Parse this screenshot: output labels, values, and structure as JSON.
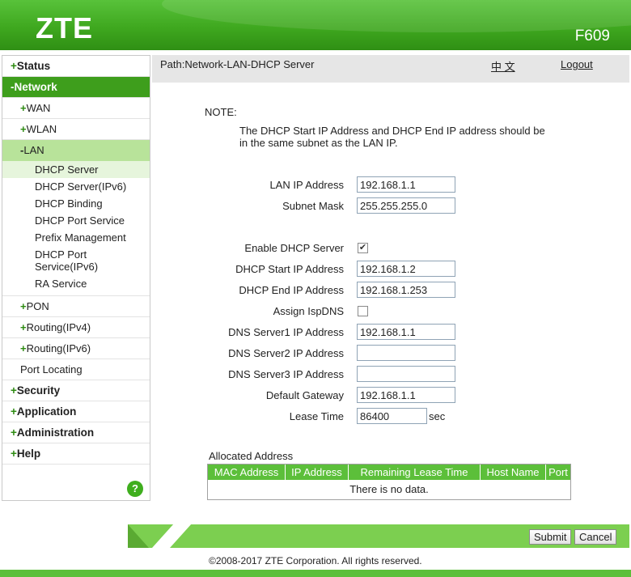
{
  "header": {
    "logo": "ZTE",
    "model": "F609"
  },
  "sidebar": {
    "items": [
      {
        "sign": "+",
        "label": "Status",
        "level": "top"
      },
      {
        "sign": "-",
        "label": "Network",
        "level": "top-active"
      },
      {
        "sign": "+",
        "label": "WAN",
        "level": "sub"
      },
      {
        "sign": "+",
        "label": "WLAN",
        "level": "sub"
      },
      {
        "sign": "-",
        "label": "LAN",
        "level": "sub-active"
      }
    ],
    "leaves": [
      "DHCP Server",
      "DHCP Server(IPv6)",
      "DHCP Binding",
      "DHCP Port Service",
      "Prefix Management",
      "DHCP Port",
      "Service(IPv6)",
      "RA Service"
    ],
    "items_after": [
      {
        "sign": "+",
        "label": "PON",
        "level": "sub"
      },
      {
        "sign": "+",
        "label": "Routing(IPv4)",
        "level": "sub"
      },
      {
        "sign": "+",
        "label": "Routing(IPv6)",
        "level": "sub"
      },
      {
        "sign": "",
        "label": "Port Locating",
        "level": "sub"
      },
      {
        "sign": "+",
        "label": "Security",
        "level": "top"
      },
      {
        "sign": "+",
        "label": "Application",
        "level": "top"
      },
      {
        "sign": "+",
        "label": "Administration",
        "level": "top"
      },
      {
        "sign": "+",
        "label": "Help",
        "level": "top"
      }
    ],
    "help_icon": "?"
  },
  "pathbar": {
    "path": "Path:Network-LAN-DHCP Server",
    "lang": "中 文",
    "logout": "Logout"
  },
  "note": {
    "label": "NOTE:",
    "text": "The DHCP Start IP Address and DHCP End IP address should be in the same subnet as the LAN IP."
  },
  "form": {
    "lan_ip_label": "LAN IP Address",
    "lan_ip": "192.168.1.1",
    "subnet_label": "Subnet Mask",
    "subnet": "255.255.255.0",
    "enable_dhcp_label": "Enable DHCP Server",
    "enable_dhcp_mark": "✔",
    "start_ip_label": "DHCP Start IP Address",
    "start_ip": "192.168.1.2",
    "end_ip_label": "DHCP End IP Address",
    "end_ip": "192.168.1.253",
    "isp_dns_label": "Assign IspDNS",
    "isp_dns_mark": "",
    "dns1_label": "DNS Server1 IP Address",
    "dns1": "192.168.1.1",
    "dns2_label": "DNS Server2 IP Address",
    "dns2": "",
    "dns3_label": "DNS Server3 IP Address",
    "dns3": "",
    "gateway_label": "Default Gateway",
    "gateway": "192.168.1.1",
    "lease_label": "Lease Time",
    "lease": "86400",
    "lease_unit": "sec"
  },
  "allocated": {
    "title": "Allocated Address",
    "columns": [
      "MAC Address",
      "IP Address",
      "Remaining Lease Time",
      "Host Name",
      "Port"
    ],
    "empty": "There is no data."
  },
  "buttons": {
    "submit": "Submit",
    "cancel": "Cancel"
  },
  "footer": {
    "copyright": "©2008-2017 ZTE Corporation. All rights reserved."
  }
}
